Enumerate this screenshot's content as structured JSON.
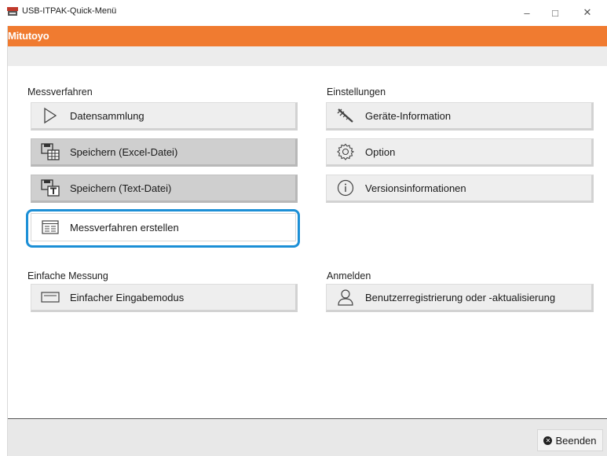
{
  "window": {
    "title": "USB-ITPAK-Quick-Menü",
    "minimize_glyph": "–",
    "maximize_glyph": "□",
    "close_glyph": "✕"
  },
  "brand": {
    "logo_text": "Mitutoyo",
    "color": "#f07b30"
  },
  "sections": {
    "measurement": {
      "label": "Messverfahren",
      "buttons": [
        {
          "label": "Datensammlung",
          "icon": "play-outline-icon"
        },
        {
          "label": "Speichern (Excel-Datei)",
          "icon": "save-table-icon"
        },
        {
          "label": "Speichern (Text-Datei)",
          "icon": "save-text-icon"
        },
        {
          "label": "Messverfahren erstellen",
          "icon": "create-procedure-icon",
          "selected": true
        }
      ]
    },
    "settings": {
      "label": "Einstellungen",
      "buttons": [
        {
          "label": "Geräte-Information",
          "icon": "caliper-icon"
        },
        {
          "label": "Option",
          "icon": "gear-icon"
        },
        {
          "label": "Versionsinformationen",
          "icon": "info-icon"
        }
      ]
    },
    "simple": {
      "label": "Einfache Messung",
      "buttons": [
        {
          "label": "Einfacher Eingabemodus",
          "icon": "input-field-icon"
        }
      ]
    },
    "login": {
      "label": "Anmelden",
      "buttons": [
        {
          "label": "Benutzerregistrierung oder -aktualisierung",
          "icon": "user-icon"
        }
      ]
    }
  },
  "footer": {
    "quit_label": "Beenden",
    "quit_icon": "close-circle-icon"
  },
  "colors": {
    "selection": "#1c8fd6",
    "accent": "#f07b30"
  }
}
